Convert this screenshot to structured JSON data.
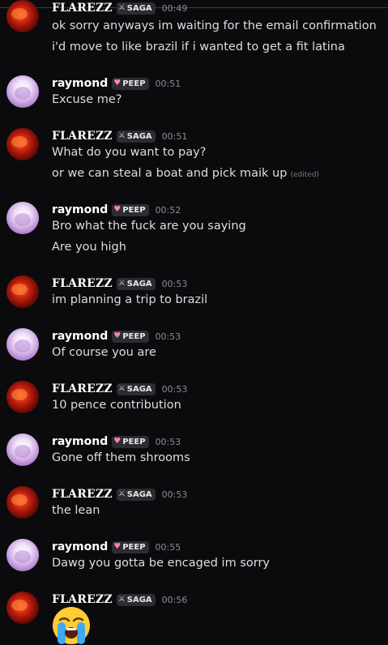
{
  "messages": [
    {
      "user": "FLAREZZ",
      "tag": "SAGA",
      "time": "00:49",
      "lines": [
        "ok sorry anyways im waiting for the email confirmation",
        "i'd move to like brazil if i wanted to get a fit latina"
      ]
    },
    {
      "user": "raymond",
      "tag": "PEEP",
      "time": "00:51",
      "lines": [
        "Excuse me?"
      ]
    },
    {
      "user": "FLAREZZ",
      "tag": "SAGA",
      "time": "00:51",
      "lines": [
        "What do you want to pay?",
        "or we can steal a boat and pick maik up"
      ],
      "edited": "(edited)"
    },
    {
      "user": "raymond",
      "tag": "PEEP",
      "time": "00:52",
      "lines": [
        "Bro what the fuck are you saying",
        "Are you high"
      ]
    },
    {
      "user": "FLAREZZ",
      "tag": "SAGA",
      "time": "00:53",
      "lines": [
        "im planning a trip to brazil"
      ]
    },
    {
      "user": "raymond",
      "tag": "PEEP",
      "time": "00:53",
      "lines": [
        "Of course you are"
      ]
    },
    {
      "user": "FLAREZZ",
      "tag": "SAGA",
      "time": "00:53",
      "lines": [
        "10 pence contribution"
      ]
    },
    {
      "user": "raymond",
      "tag": "PEEP",
      "time": "00:53",
      "lines": [
        "Gone off them shrooms"
      ]
    },
    {
      "user": "FLAREZZ",
      "tag": "SAGA",
      "time": "00:53",
      "lines": [
        "the lean"
      ]
    },
    {
      "user": "raymond",
      "tag": "PEEP",
      "time": "00:55",
      "lines": [
        "Dawg you gotta be encaged im sorry"
      ]
    },
    {
      "user": "FLAREZZ",
      "tag": "SAGA",
      "time": "00:56",
      "emoji": "loudly-crying-face"
    }
  ],
  "colors": {
    "background": "#0b0b0d",
    "text": "#dbdee1",
    "timestamp": "#8a8d93",
    "tag_bg": "#2b2d31",
    "peep_heart": "#ff7fbf"
  }
}
